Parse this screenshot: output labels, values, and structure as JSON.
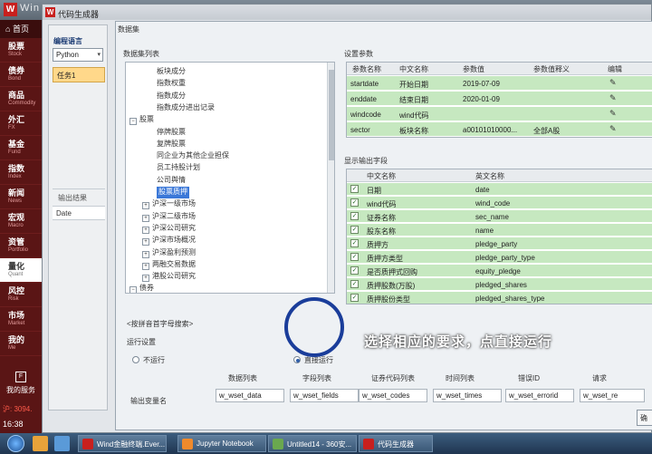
{
  "app": {
    "title": "Win",
    "logo": "W",
    "home": "首页"
  },
  "sidebar": [
    {
      "cn": "股票",
      "en": "Stock"
    },
    {
      "cn": "债券",
      "en": "Bond"
    },
    {
      "cn": "商品",
      "en": "Commodity"
    },
    {
      "cn": "外汇",
      "en": "FX"
    },
    {
      "cn": "基金",
      "en": "Fund"
    },
    {
      "cn": "指数",
      "en": "Index"
    },
    {
      "cn": "新闻",
      "en": "News"
    },
    {
      "cn": "宏观",
      "en": "Macro"
    },
    {
      "cn": "资管",
      "en": "Portfolio"
    },
    {
      "cn": "量化",
      "en": "Quant"
    },
    {
      "cn": "风控",
      "en": "Risk"
    },
    {
      "cn": "市场",
      "en": "Market"
    },
    {
      "cn": "我的",
      "en": "Me"
    }
  ],
  "sidebar_service": "我的服务",
  "sidebar_quote": "沪: 3094.",
  "clock": "16:38",
  "window": {
    "title": "代码生成器"
  },
  "left_panel": {
    "lang_label": "编程语言",
    "lang_value": "Python",
    "task": "任务1",
    "output_label": "输出结果",
    "date_label": "Date"
  },
  "dialog": {
    "title": "数据集",
    "dataset_label": "数据集列表",
    "tree": [
      {
        "label": "板块成分",
        "toggle": ""
      },
      {
        "label": "指数权重",
        "toggle": ""
      },
      {
        "label": "指数成分",
        "toggle": ""
      },
      {
        "label": "指数成分进出记录",
        "toggle": ""
      },
      {
        "label": "股票",
        "toggle": "-"
      },
      {
        "label": "停牌股票",
        "toggle": ""
      },
      {
        "label": "复牌股票",
        "toggle": ""
      },
      {
        "label": "同企业为其他企业担保",
        "toggle": ""
      },
      {
        "label": "员工持股计划",
        "toggle": ""
      },
      {
        "label": "公司舆情",
        "toggle": ""
      },
      {
        "label": "股票质押",
        "toggle": "",
        "selected": true
      },
      {
        "label": "沪深一级市场",
        "toggle": "+"
      },
      {
        "label": "沪深二级市场",
        "toggle": "+"
      },
      {
        "label": "沪深公司研究",
        "toggle": "+"
      },
      {
        "label": "沪深市场概况",
        "toggle": "+"
      },
      {
        "label": "沪深盈利预测",
        "toggle": "+"
      },
      {
        "label": "两融交易数据",
        "toggle": "+"
      },
      {
        "label": "港股公司研究",
        "toggle": "+"
      },
      {
        "label": "债券",
        "toggle": "-"
      }
    ],
    "settings_label": "设置参数",
    "params_headers": [
      "参数名称",
      "中文名称",
      "参数值",
      "参数值释义",
      "编辑"
    ],
    "params": [
      {
        "name": "startdate",
        "cn": "开始日期",
        "value": "2019-07-09",
        "desc": ""
      },
      {
        "name": "enddate",
        "cn": "结束日期",
        "value": "2020-01-09",
        "desc": ""
      },
      {
        "name": "windcode",
        "cn": "wind代码",
        "value": "",
        "desc": ""
      },
      {
        "name": "sector",
        "cn": "板块名称",
        "value": "a00101010000...",
        "desc": "全部A股"
      }
    ],
    "fields_label": "显示输出字段",
    "fields_headers": [
      "中文名称",
      "英文名称"
    ],
    "fields": [
      {
        "cn": "日期",
        "en": "date"
      },
      {
        "cn": "wind代码",
        "en": "wind_code"
      },
      {
        "cn": "证券名称",
        "en": "sec_name"
      },
      {
        "cn": "股东名称",
        "en": "name"
      },
      {
        "cn": "质押方",
        "en": "pledge_party"
      },
      {
        "cn": "质押方类型",
        "en": "pledge_party_type"
      },
      {
        "cn": "是否质押式回购",
        "en": "equity_pledge"
      },
      {
        "cn": "质押股数(万股)",
        "en": "pledged_shares"
      },
      {
        "cn": "质押股份类型",
        "en": "pledged_shares_type"
      }
    ],
    "search_hint": "<按拼音首字母搜索>",
    "run_label": "运行设置",
    "run_options": [
      "不运行",
      "直接运行"
    ],
    "output_var_label": "输出变量名",
    "columns": [
      "数据列表",
      "字段列表",
      "证券代码列表",
      "时间列表",
      "错误ID",
      "请求"
    ],
    "vars": [
      "w_wset_data",
      "w_wset_fields",
      "w_wset_codes",
      "w_wset_times",
      "w_wset_errorid",
      "w_wset_re"
    ],
    "ok": "确"
  },
  "caption": "选择相应的要求，点直接运行",
  "taskbar": [
    "Wind金融终端.Ever...",
    "Jupyter Notebook",
    "Untitled14 - 360安...",
    "代码生成器"
  ]
}
